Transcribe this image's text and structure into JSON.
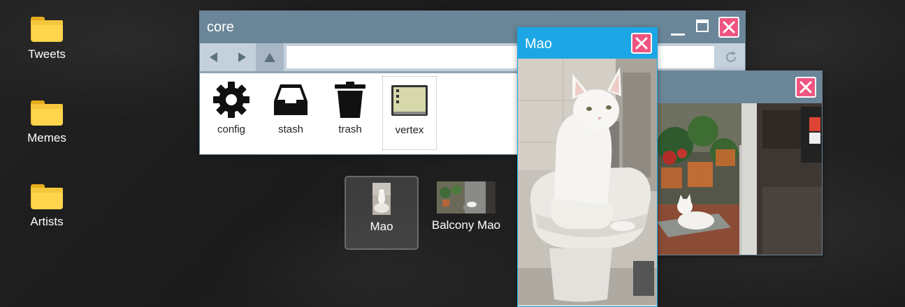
{
  "desktop": {
    "icons": [
      {
        "label": "Tweets",
        "icon": "folder-icon"
      },
      {
        "label": "Memes",
        "icon": "folder-icon"
      },
      {
        "label": "Artists",
        "icon": "folder-icon"
      }
    ],
    "files": [
      {
        "label": "Mao",
        "selected": true
      },
      {
        "label": "Balcony Mao",
        "selected": false
      }
    ]
  },
  "explorer": {
    "title": "core",
    "nav": {
      "back": "back-arrow-icon",
      "forward": "forward-arrow-icon",
      "up": "up-arrow-icon",
      "refresh": "refresh-icon",
      "address_value": ""
    },
    "items": [
      {
        "label": "config",
        "icon": "gear-icon"
      },
      {
        "label": "stash",
        "icon": "inbox-icon"
      },
      {
        "label": "trash",
        "icon": "trash-icon"
      },
      {
        "label": "vertex",
        "icon": "terminal-app-icon"
      }
    ],
    "controls": {
      "minimize": "minimize-icon",
      "maximize": "maximize-icon",
      "close": "close-icon"
    }
  },
  "viewer_mao": {
    "title": "Mao",
    "image": "white-cat-on-toilet"
  },
  "viewer_balcony": {
    "title": "",
    "image": "white-cat-on-balcony-mat"
  },
  "colors": {
    "titlebar": "#6a8698",
    "active_titlebar": "#1ca6e5",
    "close": "#ef5480",
    "folder": "#f6c63c"
  }
}
